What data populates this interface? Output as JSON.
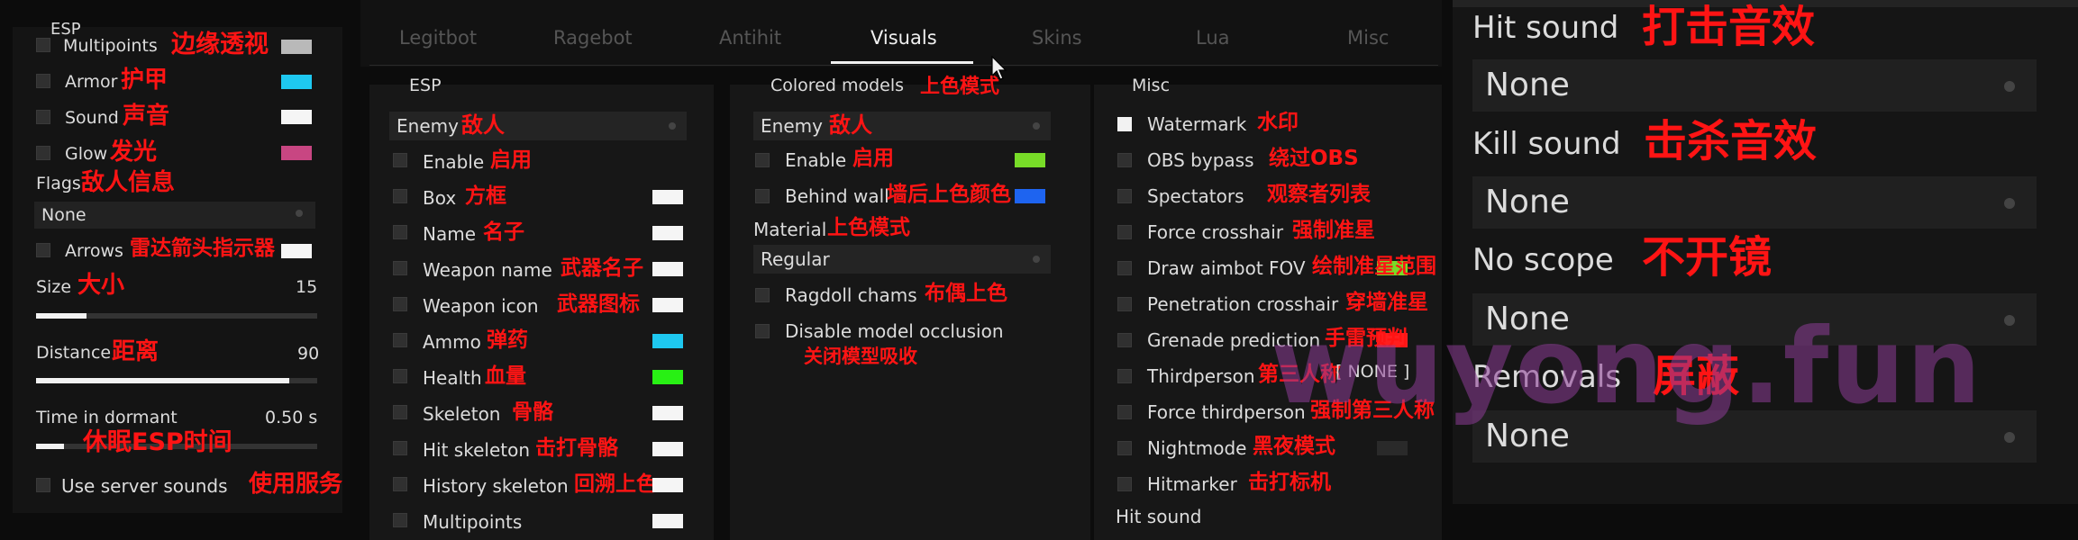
{
  "left": {
    "title": "ESP",
    "items": [
      {
        "label": "Multipoints",
        "ann": "边缘透视",
        "color": "#b9b9b9"
      },
      {
        "label": "Armor",
        "ann": "护甲",
        "color": "#1ec8f0"
      },
      {
        "label": "Sound",
        "ann": "声音",
        "color": "#f5f5f5"
      },
      {
        "label": "Glow",
        "ann": "发光",
        "color": "#c84682"
      }
    ],
    "flags_label": "Flags",
    "flags_ann": "敌人信息",
    "flags_value": "None",
    "arrows_label": "Arrows",
    "arrows_ann": "雷达箭头指示器",
    "size_label": "Size",
    "size_ann": "大小",
    "size_value": "15",
    "size_fraction": 0.18,
    "distance_label": "Distance",
    "distance_ann": "距离",
    "distance_value": "90",
    "distance_fraction": 0.9,
    "dormant_label": "Time in dormant",
    "dormant_ann": "休眠ESP时间",
    "dormant_value": "0.50 s",
    "dormant_fraction": 0.1,
    "server_label": "Use server sounds",
    "server_ann": "使用服务"
  },
  "tabs": [
    {
      "label": "Legitbot",
      "active": false
    },
    {
      "label": "Ragebot",
      "active": false
    },
    {
      "label": "Antihit",
      "active": false
    },
    {
      "label": "Visuals",
      "active": true
    },
    {
      "label": "Skins",
      "active": false
    },
    {
      "label": "Lua",
      "active": false
    },
    {
      "label": "Misc",
      "active": false
    }
  ],
  "esp": {
    "title": "ESP",
    "enemy_label": "Enemy",
    "enemy_ann": "敌人",
    "items": [
      {
        "label": "Enable",
        "ann": "启用",
        "color": ""
      },
      {
        "label": "Box",
        "ann": "方框",
        "color": "#f5f5f5"
      },
      {
        "label": "Name",
        "ann": "名子",
        "color": "#f5f5f5"
      },
      {
        "label": "Weapon name",
        "ann": "武器名子",
        "color": "#f5f5f5"
      },
      {
        "label": "Weapon icon",
        "ann": "武器图标",
        "color": "#f5f5f5"
      },
      {
        "label": "Ammo",
        "ann": "弹药",
        "color": "#1ec8f0"
      },
      {
        "label": "Health",
        "ann": "血量",
        "color": "#28f014"
      },
      {
        "label": "Skeleton",
        "ann": "骨骼",
        "color": "#f5f5f5"
      },
      {
        "label": "Hit skeleton",
        "ann": "击打骨骼",
        "color": "#f5f5f5"
      },
      {
        "label": "History skeleton",
        "ann": "回溯上色",
        "color": "#f5f5f5"
      },
      {
        "label": "Multipoints",
        "ann": "",
        "color": "#f5f5f5"
      }
    ]
  },
  "colored": {
    "title": "Colored models",
    "title_ann": "上色模式",
    "enemy_label": "Enemy",
    "enemy_ann": "敌人",
    "enable_label": "Enable",
    "enable_ann": "启用",
    "enable_color": "#78dc28",
    "behind_label": "Behind wall",
    "behind_ann": "墙后上色颜色",
    "behind_color": "#1e64f0",
    "material_label": "Material",
    "material_ann": "上色模式",
    "material_value": "Regular",
    "ragdoll_label": "Ragdoll chams",
    "ragdoll_ann": "布偶上色",
    "occl_label": "Disable model occlusion",
    "occl_ann": "关闭模型吸收"
  },
  "misc": {
    "title": "Misc",
    "items": [
      {
        "label": "Watermark",
        "ann": "水印",
        "checked": true
      },
      {
        "label": "OBS bypass",
        "ann": "绕过OBS",
        "checked": false
      },
      {
        "label": "Spectators",
        "ann": "观察者列表",
        "checked": false
      },
      {
        "label": "Force crosshair",
        "ann": "强制准星",
        "checked": false
      },
      {
        "label": "Draw aimbot FOV",
        "ann": "绘制准星范围",
        "checked": false
      },
      {
        "label": "Penetration crosshair",
        "ann": "穿墙准星",
        "checked": false
      },
      {
        "label": "Grenade prediction",
        "ann": "手雷预判",
        "checked": false
      },
      {
        "label": "Thirdperson",
        "ann": "第三人称",
        "checked": false
      },
      {
        "label": "Force thirdperson",
        "ann": "强制第三人称",
        "checked": false
      },
      {
        "label": "Nightmode",
        "ann": "黑夜模式",
        "checked": false
      },
      {
        "label": "Hitmarker",
        "ann": "击打标机",
        "checked": false
      }
    ],
    "thirdperson_key": "[ NONE ]",
    "fov_color": "#78dc28",
    "grenade_color": "#ff1e1e",
    "night_color": "#2a2a2a",
    "hit_sound_label": "Hit sound"
  },
  "right": {
    "hit_label": "Hit sound",
    "hit_ann": "打击音效",
    "hit_value": "None",
    "kill_label": "Kill sound",
    "kill_ann": "击杀音效",
    "kill_value": "None",
    "noscope_label": "No scope",
    "noscope_ann": "不开镜",
    "noscope_value": "None",
    "removals_label": "Removals",
    "removals_ann": "屏蔽",
    "removals_value": "None"
  },
  "watermark": "wuyong.fun"
}
